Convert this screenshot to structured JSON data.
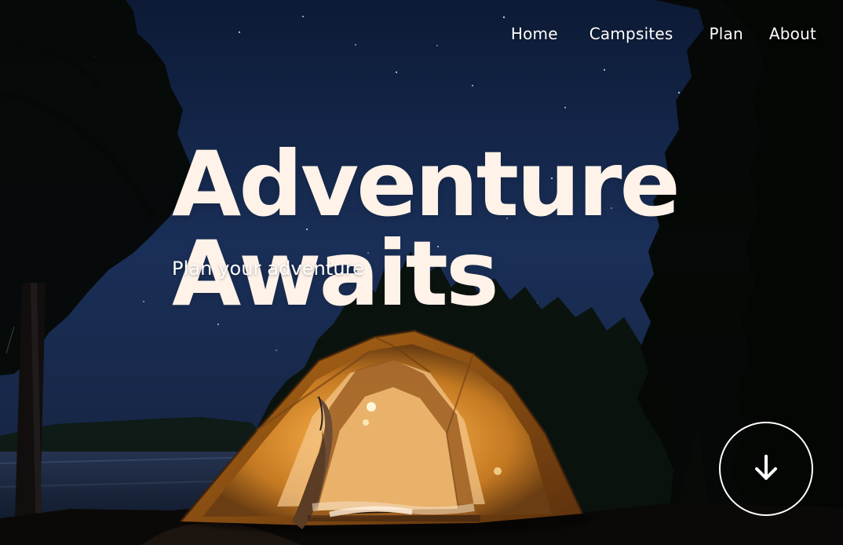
{
  "nav": {
    "items": [
      {
        "label": "Home"
      },
      {
        "label": "Campsites"
      },
      {
        "label": "Plan"
      },
      {
        "label": "About"
      }
    ]
  },
  "hero": {
    "title_line1": "Adventure",
    "title_line2": "Awaits",
    "subtitle": "Plan your adventure",
    "scroll_icon": "arrow-down-icon"
  },
  "colors": {
    "title": "#fff2e8",
    "text": "#ffffff",
    "sky_top": "#0f1d3d",
    "sky_mid": "#1c2f59",
    "tent": "#d78a2a"
  }
}
